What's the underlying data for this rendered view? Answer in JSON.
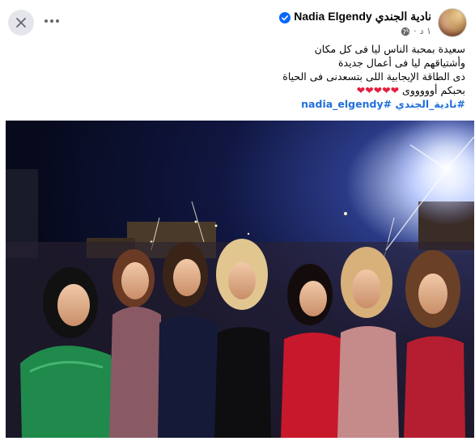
{
  "post": {
    "author": {
      "name": "نادية الجندي Nadia Elgendy",
      "verified": true,
      "avatar_icon": "avatar-photo"
    },
    "meta": {
      "time": "١ د",
      "separator": "·",
      "audience_icon": "globe-icon"
    },
    "actions": {
      "more_icon": "more-horizontal-icon",
      "close_icon": "close-icon"
    },
    "text_lines": [
      "سعيدة بمحبة الناس ليا فى كل مكان",
      "وأشتياقهم ليا فى أعمال جديدة",
      "دى الطاقة الإيجابية اللى بتسعدنى فى الحياة",
      "بحبكم أوووووى"
    ],
    "hearts": "❤❤❤❤❤",
    "hashtag": "#نادية_الجندي #nadia_elgendy",
    "photo_alt_icon": "group-photo"
  },
  "colors": {
    "link": "#216fdb",
    "heart": "#e41e3f",
    "secondary_text": "#65676b",
    "button_bg": "#e4e6eb"
  }
}
